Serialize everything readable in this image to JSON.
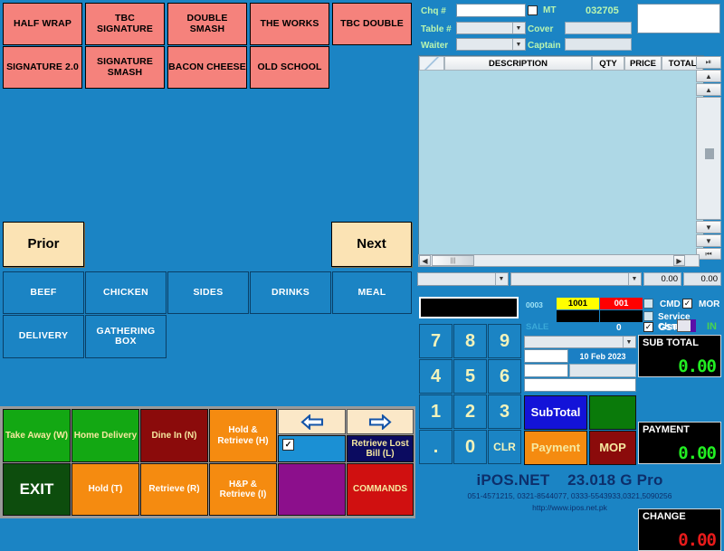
{
  "app": {
    "name": "iPOS.NET",
    "version": "23.018 G Pro",
    "phones": "051-4571215, 0321-8544077, 0333-5543933,0321,5090256",
    "website": "http://www.ipos.net.pk"
  },
  "header": {
    "chq_label": "Chq #",
    "chq_value": "",
    "table_label": "Table #",
    "table_value": "",
    "waiter_label": "Waiter",
    "waiter_value": "",
    "mt_label": "MT",
    "mt_checked": false,
    "bill_number": "032705",
    "cover_label": "Cover",
    "cover_value": "",
    "captain_label": "Captain",
    "captain_value": "",
    "note_value": ""
  },
  "order_grid": {
    "columns": [
      "",
      "DESCRIPTION",
      "QTY",
      "PRICE",
      "TOTAL"
    ],
    "rows": []
  },
  "filter_bar": {
    "left_combo_value": "",
    "right_combo_value": "",
    "amount_1": "0.00",
    "amount_2": "0.00"
  },
  "status": {
    "code": "0003",
    "chip_yellow": "1001",
    "chip_red": "001",
    "cmd_label": "CMD",
    "cmd_checked": true,
    "mor_label": "MOR",
    "service_charges_label": "Service Charges",
    "service_charges_checked": false,
    "mor_checked": false,
    "sale_label": "SALE",
    "sale_value": "0",
    "gst_label": "GST",
    "gst_checked": true,
    "in_label": "IN"
  },
  "products": [
    {
      "label": "HALF WRAP"
    },
    {
      "label": "TBC SIGNATURE"
    },
    {
      "label": "DOUBLE SMASH"
    },
    {
      "label": "THE WORKS"
    },
    {
      "label": "TBC DOUBLE"
    },
    {
      "label": "SIGNATURE 2.0"
    },
    {
      "label": "SIGNATURE SMASH"
    },
    {
      "label": "BACON CHEESE"
    },
    {
      "label": "OLD SCHOOL"
    }
  ],
  "paging": {
    "prior_label": "Prior",
    "next_label": "Next"
  },
  "categories": [
    {
      "label": "BEEF"
    },
    {
      "label": "CHICKEN"
    },
    {
      "label": "SIDES"
    },
    {
      "label": "DRINKS"
    },
    {
      "label": "MEAL"
    },
    {
      "label": "DELIVERY"
    },
    {
      "label": "GATHERING BOX"
    }
  ],
  "functions": {
    "take_away": "Take Away (W)",
    "home_delivery": "Home Delivery",
    "dine_in": "Dine In (N)",
    "hold_retrieve": "Hold & Retrieve (H)",
    "prev_arrow": "⇦",
    "next_arrow": "⇨",
    "nav_checked": true,
    "retrieve_lost_bill": "Retrieve Lost Bill (L)",
    "exit": "EXIT",
    "hold": "Hold (T)",
    "retrieve": "Retrieve (R)",
    "hp_retrieve": "H&P & Retrieve (I)",
    "blank": "",
    "commands": "COMMANDS"
  },
  "keypad": {
    "display_value": "",
    "keys": [
      "7",
      "8",
      "9",
      "4",
      "5",
      "6",
      "1",
      "2",
      "3",
      ".",
      "0",
      "CLR"
    ]
  },
  "entry": {
    "combo_value": "",
    "field_a": "",
    "date": "10 Feb 2023",
    "field_b": "",
    "field_c": "",
    "field_d": ""
  },
  "actions": {
    "subtotal": "SubTotal",
    "green": "",
    "payment": "Payment",
    "mop": "MOP"
  },
  "totals": {
    "subtotal_label": "SUB TOTAL",
    "subtotal_value": "0.00",
    "payment_label": "PAYMENT",
    "payment_value": "0.00",
    "change_label": "CHANGE",
    "change_value": "0.00"
  },
  "colors": {
    "background": "#1b84c4",
    "product": "#f5827c",
    "page": "#fbe3b4",
    "green_value": "#22ee22",
    "red_value": "#e81b1b"
  }
}
